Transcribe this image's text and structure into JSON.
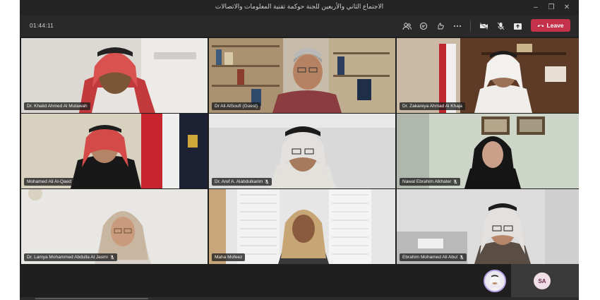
{
  "window": {
    "title": "الاجتماع الثاني والأربعين للجنة حوكمة تقنية المعلومات والاتصالات",
    "controls": [
      {
        "name": "minimize-icon",
        "glyph": "–"
      },
      {
        "name": "restore-icon",
        "glyph": "❐"
      },
      {
        "name": "close-icon",
        "glyph": "✕"
      }
    ]
  },
  "meeting": {
    "timer": "01:44:11",
    "leave_label": "Leave",
    "toolbar_icons": [
      "people-icon",
      "chat-icon",
      "reactions-icon",
      "more-icon",
      "camera-off-icon",
      "mic-off-icon",
      "share-icon"
    ]
  },
  "participants": [
    {
      "name": "Dr. Khalid Ahmed Al Mutawah",
      "muted": false
    },
    {
      "name": "Dr Ali AlSoufi (Guest)",
      "muted": false
    },
    {
      "name": "Dr. Zakareya Ahmad Al Khaja",
      "muted": false
    },
    {
      "name": "Mohamed Ali Al-Qaed",
      "muted": false
    },
    {
      "name": "Dr. Aref A. Alabdulkarim",
      "muted": true
    },
    {
      "name": "Nawal Ebrahim Alkhater",
      "muted": true
    },
    {
      "name": "Dr. Lamya Mohammed Abdulla Al Jasmi",
      "muted": true
    },
    {
      "name": "Maha Mofeez",
      "muted": false
    },
    {
      "name": "Ebrahim Mohamed Ali Abul",
      "muted": true
    }
  ],
  "self": {
    "initials": "SA"
  },
  "colors": {
    "accent": "#b9a6ea",
    "leave": "#c4314b",
    "background": "#1f1f1f"
  }
}
